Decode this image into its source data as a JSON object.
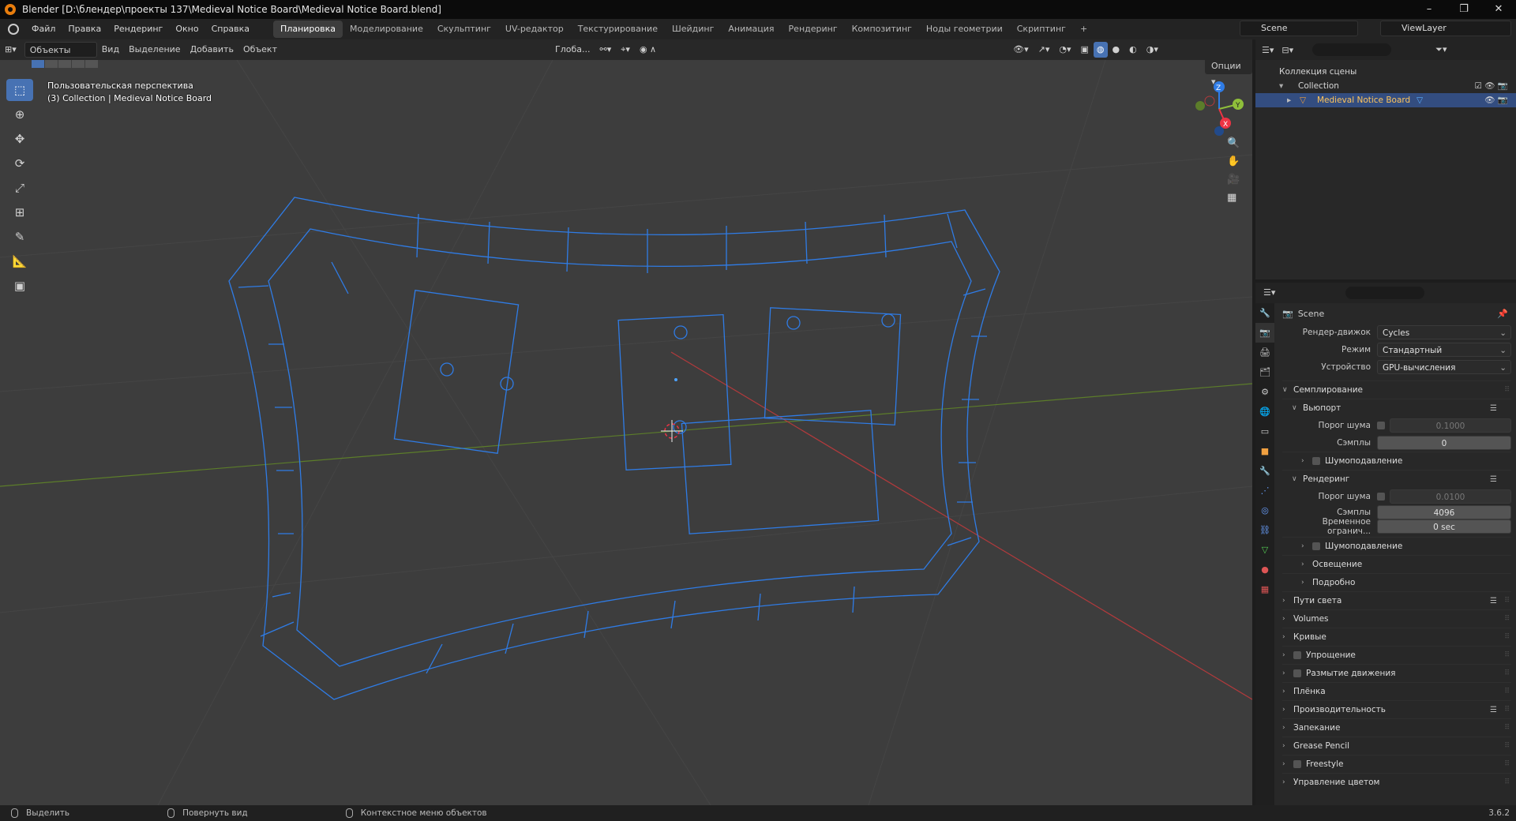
{
  "window": {
    "title": "Blender [D:\\блендер\\проекты 137\\Medieval Notice Board\\Medieval Notice Board.blend]",
    "minimize": "–",
    "maximize": "❐",
    "close": "✕"
  },
  "menubar": {
    "items": [
      "Файл",
      "Правка",
      "Рендеринг",
      "Окно",
      "Справка"
    ],
    "workspaces": [
      "Планировка",
      "Моделирование",
      "Скульптинг",
      "UV-редактор",
      "Текстурирование",
      "Шейдинг",
      "Анимация",
      "Рендеринг",
      "Композитинг",
      "Ноды геометрии",
      "Скриптинг"
    ],
    "add_workspace": "+",
    "scene": "Scene",
    "view_layer": "ViewLayer"
  },
  "viewport_header": {
    "mode": "Объекты",
    "menus": [
      "Вид",
      "Выделение",
      "Добавить",
      "Объект"
    ],
    "orientation": "Глоба...",
    "options": "Опции"
  },
  "viewport": {
    "perspective": "Пользовательская перспектива",
    "collection_info": "(3) Collection | Medieval Notice Board",
    "gizmo_axes": [
      "Z",
      "Y",
      "X"
    ]
  },
  "outliner": {
    "rows": [
      "Коллекция сцены",
      "Collection",
      "Medieval Notice Board"
    ]
  },
  "properties": {
    "scene_title": "Scene",
    "fields": [
      {
        "label": "Рендер-движок",
        "value": "Cycles"
      },
      {
        "label": "Режим",
        "value": "Стандартный"
      },
      {
        "label": "Устройство",
        "value": "GPU-вычисления"
      }
    ],
    "sampling": "Семплирование",
    "viewport_sub": "Вьюпорт",
    "viewport_noise_label": "Порог шума",
    "viewport_noise": "0.1000",
    "viewport_samples_label": "Сэмплы",
    "viewport_samples": "0",
    "denoise": "Шумоподавление",
    "render_sub": "Рендеринг",
    "render_noise_label": "Порог шума",
    "render_noise": "0.0100",
    "render_samples_label": "Сэмплы",
    "render_samples": "4096",
    "time_limit_label": "Временное огранич...",
    "time_limit": "0 sec",
    "render_denoise": "Шумоподавление",
    "lighting": "Освещение",
    "advanced": "Подробно",
    "panels": [
      "Пути света",
      "Volumes",
      "Кривые",
      "Упрощение",
      "Размытие движения",
      "Плёнка",
      "Производительность",
      "Запекание",
      "Grease Pencil",
      "Freestyle",
      "Управление цветом"
    ]
  },
  "statusbar": {
    "select": "Выделить",
    "rotate": "Повернуть вид",
    "context": "Контекстное меню объектов",
    "version": "3.6.2"
  },
  "colors": {
    "accent": "#4772b3",
    "wire": "#2f7ce6",
    "x_axis": "#c0393b",
    "y_axis": "#6a9a2a"
  }
}
